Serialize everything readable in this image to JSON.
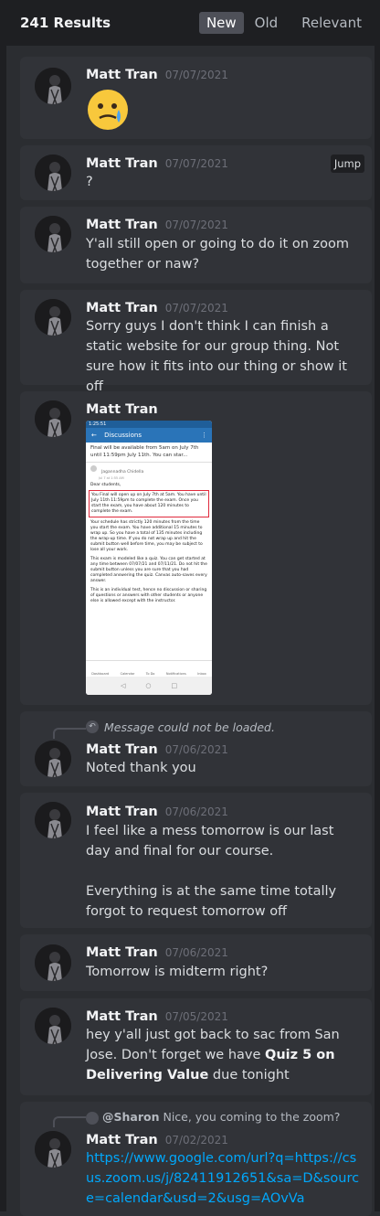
{
  "header": {
    "results_count": "241 Results",
    "tabs": [
      "New",
      "Old",
      "Relevant"
    ],
    "active_tab": "New"
  },
  "messages": [
    {
      "author": "Matt Tran",
      "date": "07/07/2021",
      "emoji": "face-holding-back-tears-emoji"
    },
    {
      "author": "Matt Tran",
      "date": "07/07/2021",
      "text": "?",
      "jump_label": "Jump"
    },
    {
      "author": "Matt Tran",
      "date": "07/07/2021",
      "text": "Y'all still open or going to do it on zoom together or naw?"
    },
    {
      "author": "Matt Tran",
      "date": "07/07/2021",
      "text": "Sorry guys I don't think I can finish a static website for our group thing. Not sure how it fits into our thing or show it off"
    },
    {
      "author": "Matt Tran",
      "date": "07/07/2021",
      "attachment": {
        "status_time": "1:25:51",
        "app_title": "Discussions",
        "preview": "Final will be available from 5am on July 7th until 11:59pm July 11th. You can star...",
        "poster": "Jagannadha Chidella",
        "posted": "Jul 7 at 1:55 AM",
        "greeting": "Dear students,",
        "highlight": "You Final will open up on July 7th at 5am. You have until July 11th 11:59pm to complete the exam. Once you start the exam, you have about 120 minutes to complete the exam.",
        "para1": "Your schedule has strictly 120 minutes from the time you start the exam. You have additional 15 minutes to wrap up. So you have a total of 135 minutes including the wrap-up time. If you do not wrap up and hit the submit button well before time, you may be subject to lose all your work.",
        "para2": "This exam is modeled like a quiz. You can get started at any time between 07/07/21 and 07/11/21. Do not hit the submit button unless you are sure that you had completed answering the quiz. Canvas auto-saves every answer.",
        "para3": "This is an individual test, hence no discussion or sharing of questions or answers with other students or anyone else is allowed except with the instructor.",
        "nav": [
          "Dashboard",
          "Calendar",
          "To Do",
          "Notifications",
          "Inbox"
        ]
      }
    },
    {
      "reply": "Message could not be loaded.",
      "author": "Matt Tran",
      "date": "07/06/2021",
      "text": "Noted thank you"
    },
    {
      "author": "Matt Tran",
      "date": "07/06/2021",
      "text": "I feel like a mess tomorrow is our last day and final for our course.",
      "text2": "Everything is at the same time totally forgot to request tomorrow off"
    },
    {
      "author": "Matt Tran",
      "date": "07/06/2021",
      "text": "Tomorrow is midterm right?"
    },
    {
      "author": "Matt Tran",
      "date": "07/05/2021",
      "text_pre": "hey y'all just got back to sac from San Jose. Don't forget we have ",
      "text_bold": "Quiz 5 on Delivering Value",
      "text_post": "  due tonight"
    },
    {
      "reply_user": "@Sharon",
      "reply": "Nice, you coming to the zoom?",
      "author": "Matt Tran",
      "date": "07/02/2021",
      "link": "https://www.google.com/url?q=https://csus.zoom.us/j/82411912651&sa=D&source=calendar&usd=2&usg=AOvVa"
    }
  ]
}
